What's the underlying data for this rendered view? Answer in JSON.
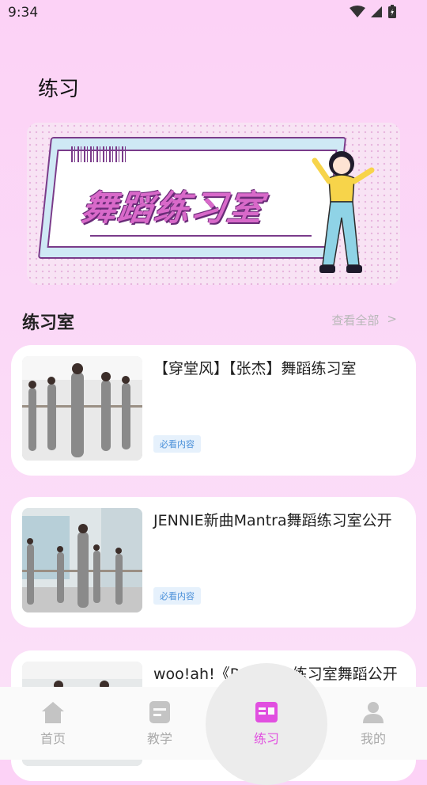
{
  "status": {
    "time": "9:34"
  },
  "page": {
    "title": "练习"
  },
  "banner": {
    "text": "舞蹈练习室"
  },
  "section": {
    "title": "练习室",
    "view_all": "查看全部",
    "view_all_arrow": ">"
  },
  "cards": [
    {
      "title": "【穿堂风】【张杰】舞蹈练习室",
      "tag": "必看内容"
    },
    {
      "title": "JENNIE新曲Mantra舞蹈练习室公开",
      "tag": "必看内容"
    },
    {
      "title": "woo!ah!《Purple》练习室舞蹈公开",
      "tag": ""
    }
  ],
  "tabs": [
    {
      "label": "首页",
      "icon": "home-icon"
    },
    {
      "label": "教学",
      "icon": "notebook-icon"
    },
    {
      "label": "练习",
      "icon": "practice-icon"
    },
    {
      "label": "我的",
      "icon": "user-icon"
    }
  ],
  "colors": {
    "accent": "#e14fe0",
    "tag_text": "#4a90d9",
    "tag_bg": "#e6f1fc"
  }
}
